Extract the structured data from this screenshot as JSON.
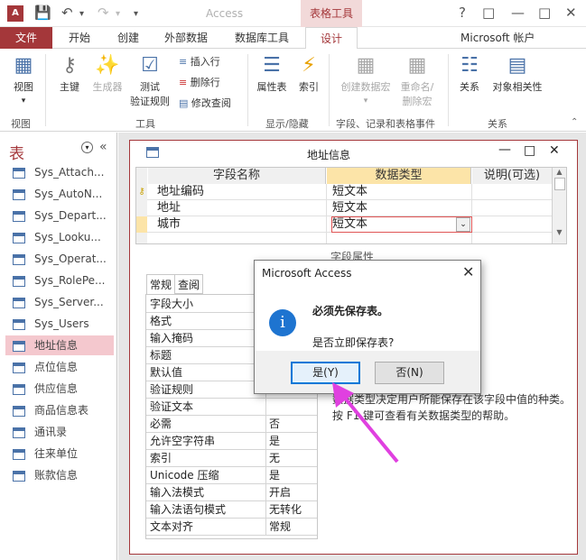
{
  "app": {
    "icon_text": "A",
    "title": "Access",
    "context_tab": "表格工具",
    "account": "Microsoft 帐户"
  },
  "tabs": [
    "文件",
    "开始",
    "创建",
    "外部数据",
    "数据库工具",
    "设计"
  ],
  "ribbon": {
    "view": "视图",
    "primary_key": "主键",
    "builder": "生成器",
    "test_rules_1": "测试",
    "test_rules_2": "验证规则",
    "insert_row": "插入行",
    "delete_row": "删除行",
    "modify_lookup": "修改查阅",
    "property_sheet": "属性表",
    "indexes": "索引",
    "create_macro": "创建数据宏",
    "rename_macro_1": "重命名/",
    "rename_macro_2": "删除宏",
    "relationships": "关系",
    "object_deps": "对象相关性",
    "groups": {
      "views": "视图",
      "tools": "工具",
      "show_hide": "显示/隐藏",
      "field_events": "字段、记录和表格事件",
      "relations": "关系"
    }
  },
  "nav": {
    "title": "表",
    "items": [
      "Sys_Attach...",
      "Sys_AutoN...",
      "Sys_Depart...",
      "Sys_Looku...",
      "Sys_Operat...",
      "Sys_RolePe...",
      "Sys_Server...",
      "Sys_Users",
      "地址信息",
      "点位信息",
      "供应信息",
      "商品信息表",
      "通讯录",
      "往来单位",
      "账款信息"
    ],
    "selected_index": 8
  },
  "doc": {
    "title": "地址信息",
    "headers": {
      "field_name": "字段名称",
      "data_type": "数据类型",
      "description": "说明(可选)"
    },
    "rows": [
      {
        "name": "地址编码",
        "type": "短文本",
        "key": true
      },
      {
        "name": "地址",
        "type": "短文本",
        "key": false
      },
      {
        "name": "城市",
        "type": "短文本",
        "key": false
      }
    ],
    "field_props_label": "字段属性",
    "prop_tabs": [
      "常规",
      "查阅"
    ],
    "props": [
      {
        "k": "字段大小",
        "v": ""
      },
      {
        "k": "格式",
        "v": ""
      },
      {
        "k": "输入掩码",
        "v": ""
      },
      {
        "k": "标题",
        "v": ""
      },
      {
        "k": "默认值",
        "v": ""
      },
      {
        "k": "验证规则",
        "v": ""
      },
      {
        "k": "验证文本",
        "v": ""
      },
      {
        "k": "必需",
        "v": "否"
      },
      {
        "k": "允许空字符串",
        "v": "是"
      },
      {
        "k": "索引",
        "v": "无"
      },
      {
        "k": "Unicode 压缩",
        "v": "是"
      },
      {
        "k": "输入法模式",
        "v": "开启"
      },
      {
        "k": "输入法语句模式",
        "v": "无转化"
      },
      {
        "k": "文本对齐",
        "v": "常规"
      }
    ],
    "help_text": "数据类型决定用户所能保存在该字段中值的种类。按 F1 键可查看有关数据类型的帮助。"
  },
  "dialog": {
    "title": "Microsoft Access",
    "icon": "i",
    "message": "必须先保存表。",
    "question": "是否立即保存表?",
    "yes": "是(Y)",
    "no": "否(N)"
  },
  "colors": {
    "accent": "#a4373a",
    "arrow": "#e040e0",
    "info": "#1e74d0"
  }
}
